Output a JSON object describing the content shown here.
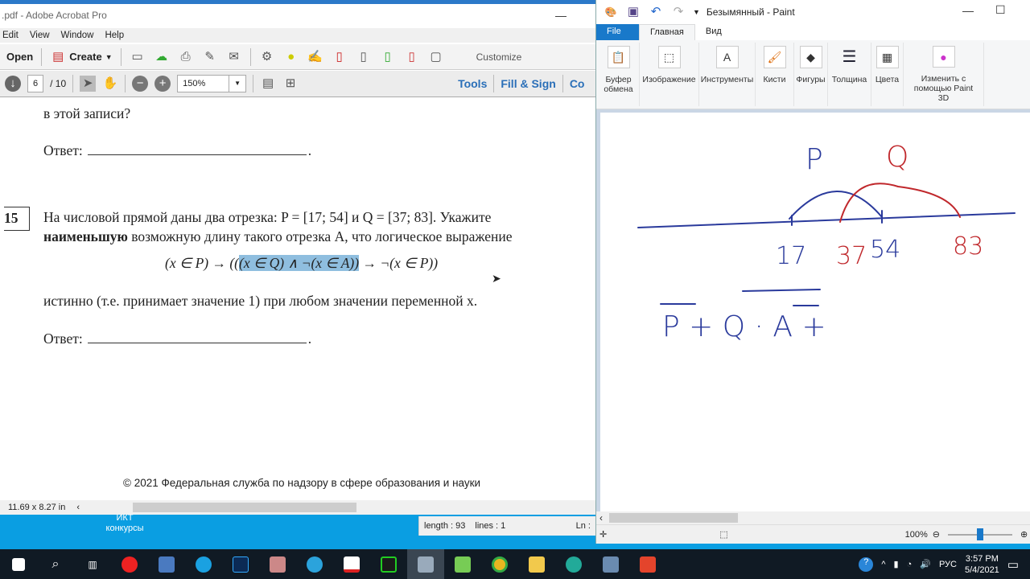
{
  "acrobat": {
    "title": ".pdf - Adobe Acrobat Pro",
    "menu": [
      "Edit",
      "View",
      "Window",
      "Help"
    ],
    "toolbar": {
      "open": "Open",
      "create": "Create",
      "customize": "Customize"
    },
    "nav": {
      "page": "6",
      "total": "/ 10",
      "zoom": "150%",
      "tools": "Tools",
      "fill_sign": "Fill & Sign",
      "comment": "Co"
    },
    "doc": {
      "prev_line": "в этой записи?",
      "answer_label": "Ответ:",
      "task_number": "15",
      "line1": "На числовой прямой даны два отрезка: P = [17; 54] и Q = [37; 83]. Укажите",
      "line2_bold": "наименьшую",
      "line2_rest": " возможную длину такого отрезка A, что логическое выражение",
      "formula_pre": "(x ∈ P) → ((",
      "formula_hl": "(x ∈ Q) ∧ ¬(x ∈ A))",
      "formula_post": " → ¬(x ∈ P))",
      "line3": "истинно (т.е. принимает значение 1) при любом значении переменной x.",
      "footer": "© 2021 Федеральная служба по надзору в сфере образования и науки"
    },
    "status": {
      "size": "11.69 x 8.27 in"
    }
  },
  "desktop": {
    "icon_label": "ИКТ конкурсы"
  },
  "notepad": {
    "length": "length : 93",
    "lines": "lines : 1",
    "ln": "Ln :"
  },
  "paint": {
    "title": "Безымянный - Paint",
    "tabs": [
      "File",
      "Главная",
      "Вид"
    ],
    "groups": [
      "Буфер обмена",
      "Изображение",
      "Инструменты",
      "Кисти",
      "Фигуры",
      "Толщина",
      "Цвета",
      "Изменить с помощью Paint 3D"
    ],
    "zoom": "100%",
    "drawing": {
      "p": "P",
      "q": "Q",
      "n17": "17",
      "n37": "37",
      "n54": "54",
      "n83": "83",
      "formula": "P + Q · A +",
      "colors": {
        "blue": "#2a3a9c",
        "red": "#c0282c"
      }
    }
  },
  "taskbar": {
    "lang": "РУС",
    "time": "3:57 PM",
    "date": "5/4/2021"
  }
}
